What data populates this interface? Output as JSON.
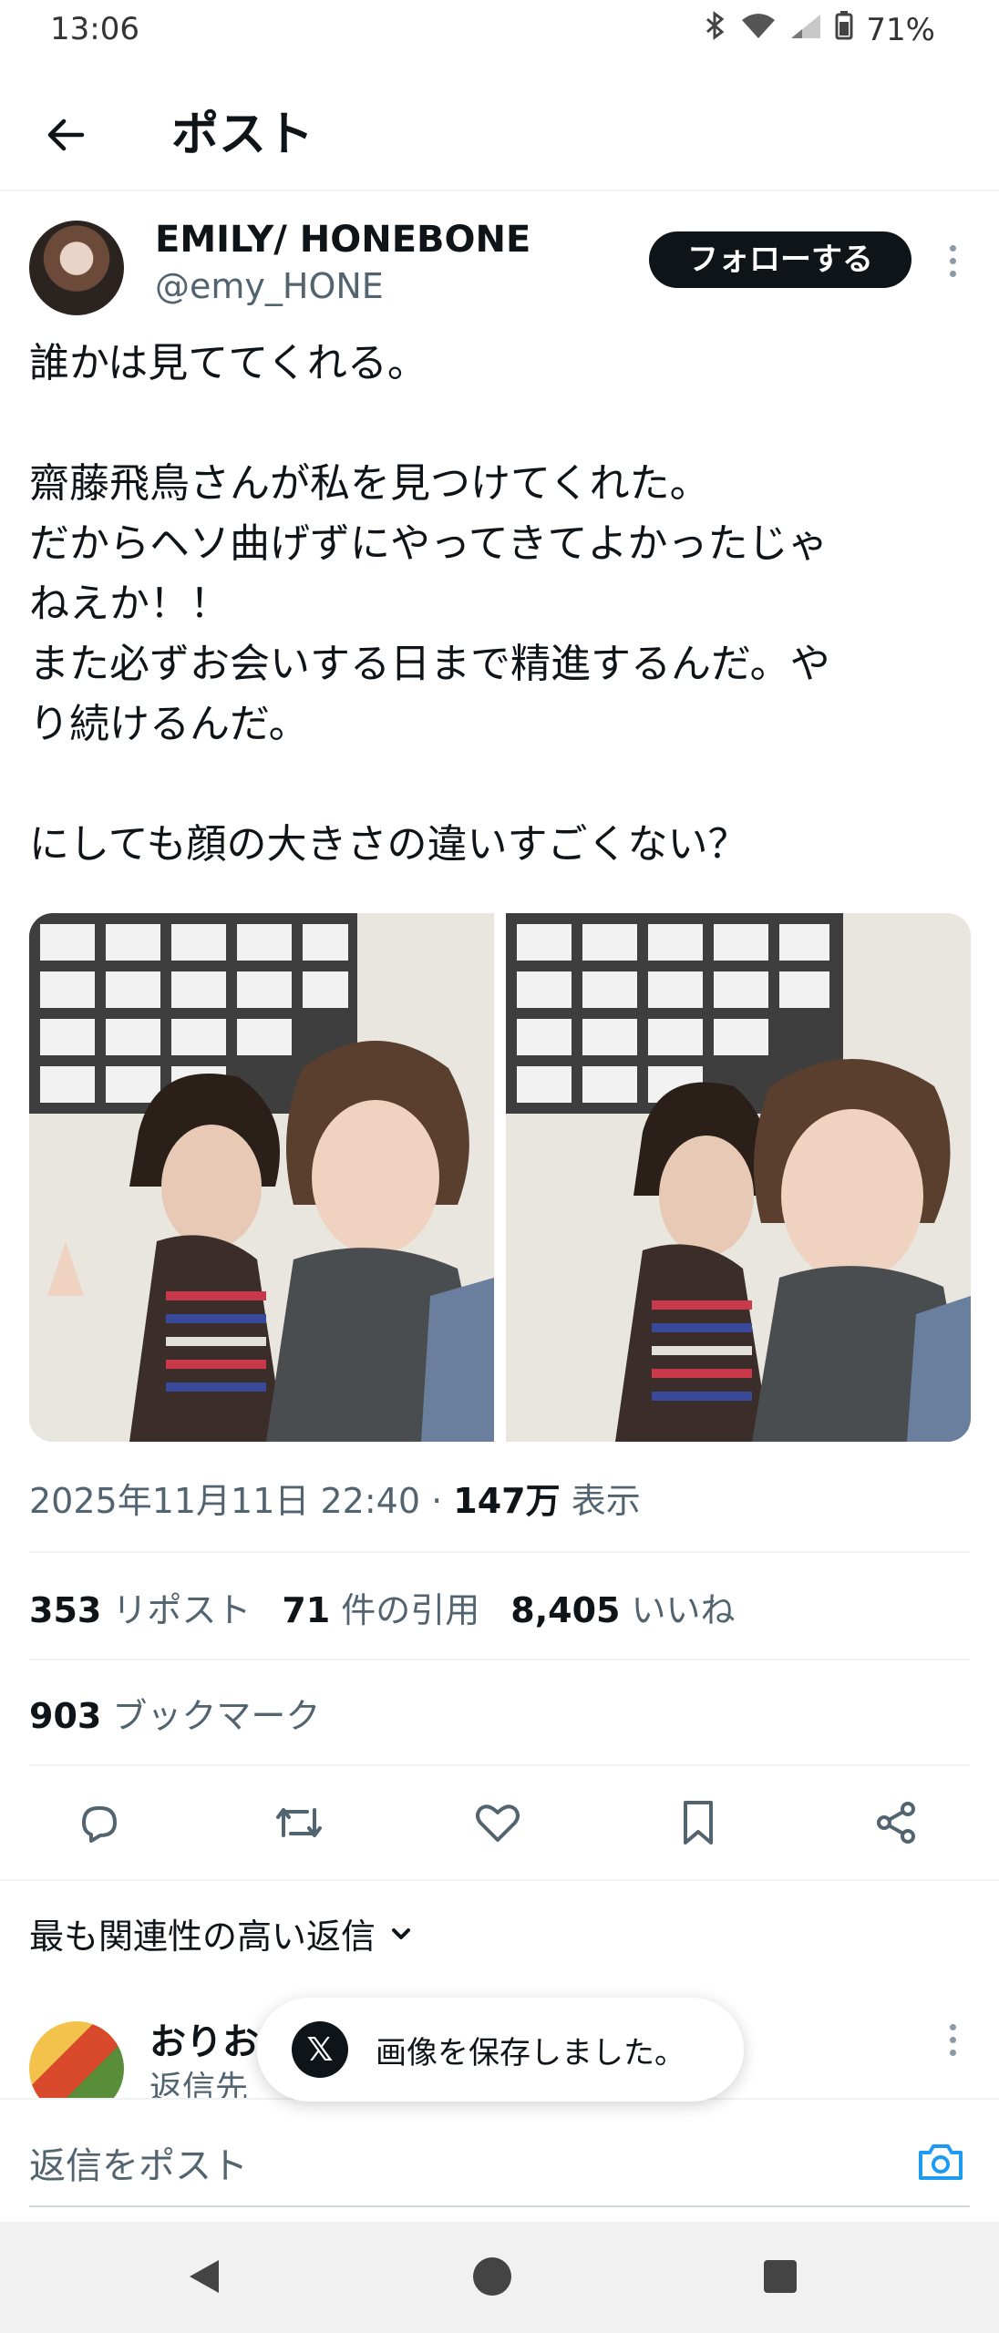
{
  "status": {
    "time": "13:06",
    "battery": "71%"
  },
  "header": {
    "title": "ポスト"
  },
  "post": {
    "author_name": "EMILY/ HONEBONE",
    "author_handle": "@emy_HONE",
    "follow_label": "フォローする",
    "lines": [
      "誰かは見ててくれる。",
      "",
      "齋藤飛鳥さんが私を見つけてくれた。",
      "だからヘソ曲げずにやってきてよかったじゃ",
      "ねえか！！",
      "また必ずお会いする日まで精進するんだ。や",
      "り続けるんだ。",
      "",
      "にしても顔の大きさの違いすごくない？"
    ],
    "date": "2025年11月11日 22:40",
    "separator": "·",
    "views_count": "147万",
    "views_label": "表示"
  },
  "stats": {
    "reposts_count": "353",
    "reposts_label": "リポスト",
    "quotes_count": "71",
    "quotes_label": "件の引用",
    "likes_count": "8,405",
    "likes_label": "いいね",
    "bookmarks_count": "903",
    "bookmarks_label": "ブックマーク"
  },
  "replies": {
    "sort_label": "最も関連性の高い返信",
    "first_reply_name": "おりお",
    "first_reply_sub": "返信先"
  },
  "toast": {
    "icon": "x-logo-icon",
    "text": "画像を保存しました。"
  },
  "composer": {
    "placeholder": "返信をポスト"
  },
  "colors": {
    "accent": "#1d9bf0",
    "text": "#0f1419",
    "muted": "#536471"
  }
}
